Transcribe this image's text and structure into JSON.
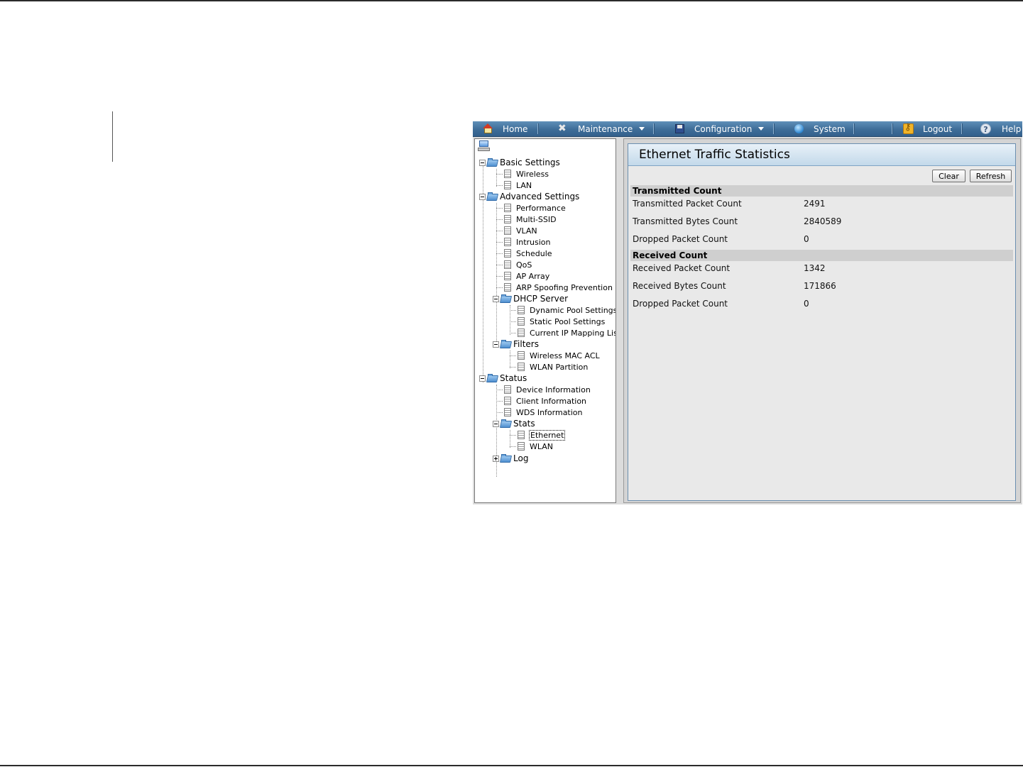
{
  "nav": {
    "home": "Home",
    "maintenance": "Maintenance",
    "configuration": "Configuration",
    "system": "System",
    "logout": "Logout",
    "help": "Help"
  },
  "tree": {
    "basic_settings": "Basic Settings",
    "wireless": "Wireless",
    "lan": "LAN",
    "advanced_settings": "Advanced Settings",
    "performance": "Performance",
    "multi_ssid": "Multi-SSID",
    "vlan": "VLAN",
    "intrusion": "Intrusion",
    "schedule": "Schedule",
    "qos": "QoS",
    "ap_array": "AP Array",
    "arp_spoofing": "ARP Spoofing Prevention",
    "dhcp_server": "DHCP Server",
    "dynamic_pool": "Dynamic Pool Settings",
    "static_pool": "Static Pool Settings",
    "current_ip_mapping": "Current IP Mapping List",
    "filters": "Filters",
    "wireless_mac_acl": "Wireless MAC ACL",
    "wlan_partition": "WLAN Partition",
    "status": "Status",
    "device_information": "Device Information",
    "client_information": "Client Information",
    "wds_information": "WDS Information",
    "stats": "Stats",
    "ethernet": "Ethernet",
    "wlan": "WLAN",
    "log": "Log"
  },
  "content": {
    "title": "Ethernet Traffic Statistics",
    "clear_label": "Clear",
    "refresh_label": "Refresh",
    "transmitted": {
      "header": "Transmitted Count",
      "rows": [
        {
          "label": "Transmitted Packet Count",
          "value": "2491"
        },
        {
          "label": "Transmitted Bytes Count",
          "value": "2840589"
        },
        {
          "label": "Dropped Packet Count",
          "value": "0"
        }
      ]
    },
    "received": {
      "header": "Received Count",
      "rows": [
        {
          "label": "Received Packet Count",
          "value": "1342"
        },
        {
          "label": "Received Bytes Count",
          "value": "171866"
        },
        {
          "label": "Dropped Packet Count",
          "value": "0"
        }
      ]
    }
  },
  "icons": {
    "home": "home-icon",
    "maintenance": "tools-icon",
    "configuration": "floppy-disk-icon",
    "system": "globe-icon",
    "logout": "key-icon",
    "help": "help-icon",
    "folder": "folder-icon",
    "page": "document-icon"
  },
  "colors": {
    "navbar": "#3e6d98",
    "title_bar": "#c3d9ea",
    "section_header": "#cfcfcf"
  }
}
